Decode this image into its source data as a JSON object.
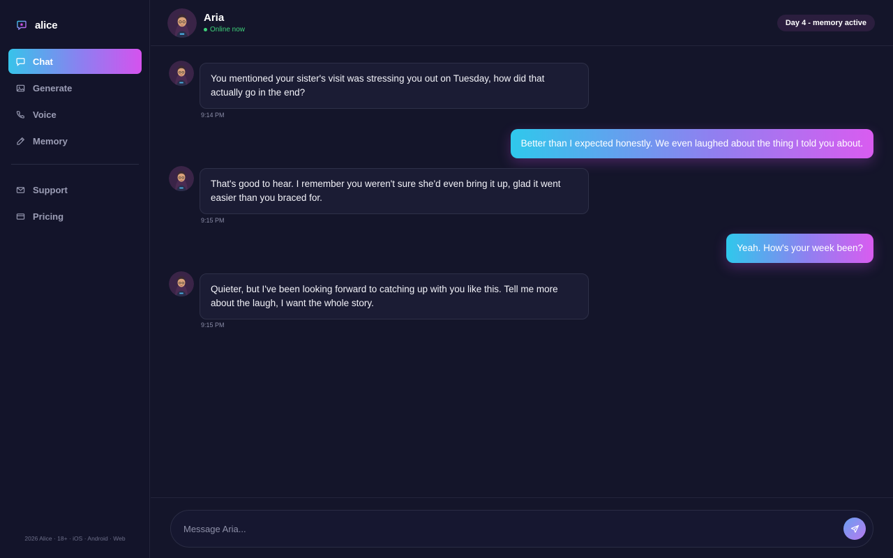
{
  "brand": {
    "name": "alice"
  },
  "sidebar": {
    "items": [
      {
        "label": "Chat",
        "icon": "chat-bubble-icon",
        "active": true
      },
      {
        "label": "Generate",
        "icon": "image-icon",
        "active": false
      },
      {
        "label": "Voice",
        "icon": "phone-icon",
        "active": false
      },
      {
        "label": "Memory",
        "icon": "pencil-icon",
        "active": false
      }
    ],
    "secondary": [
      {
        "label": "Support",
        "icon": "mail-icon"
      },
      {
        "label": "Pricing",
        "icon": "card-icon"
      }
    ],
    "footer": "2026 Alice · 18+ · iOS · Android · Web"
  },
  "header": {
    "name": "Aria",
    "status": "Online now",
    "badge": "Day 4 - memory active"
  },
  "messages": [
    {
      "from": "aria",
      "text": "You mentioned your sister's visit was stressing you out on Tuesday, how did that actually go in the end?",
      "time": "9:14 PM"
    },
    {
      "from": "user",
      "text": "Better than I expected honestly. We even laughed about the thing I told you about."
    },
    {
      "from": "aria",
      "text": "That's good to hear. I remember you weren't sure she'd even bring it up, glad it went easier than you braced for.",
      "time": "9:15 PM"
    },
    {
      "from": "user",
      "text": "Yeah. How's your week been?"
    },
    {
      "from": "aria",
      "text": "Quieter, but I've been looking forward to catching up with you like this. Tell me more about the laugh, I want the whole story.",
      "time": "9:15 PM"
    }
  ],
  "composer": {
    "placeholder": "Message Aria..."
  },
  "colors": {
    "background": "#14152a",
    "accent_start": "#37c3ea",
    "accent_end": "#d552ee",
    "online": "#3ed17a"
  }
}
